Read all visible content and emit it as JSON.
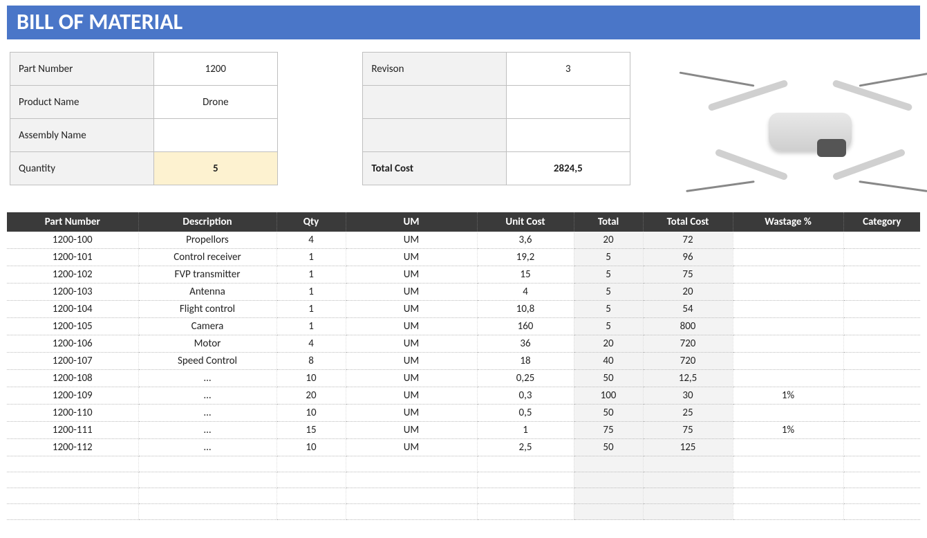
{
  "title": "BILL OF MATERIAL",
  "info_left": {
    "part_number_label": "Part Number",
    "part_number_value": "1200",
    "product_name_label": "Product Name",
    "product_name_value": "Drone",
    "assembly_name_label": "Assembly Name",
    "assembly_name_value": "",
    "quantity_label": "Quantity",
    "quantity_value": "5"
  },
  "info_right": {
    "revision_label": "Revison",
    "revision_value": "3",
    "row2_label": "",
    "row2_value": "",
    "row3_label": "",
    "row3_value": "",
    "total_cost_label": "Total Cost",
    "total_cost_value": "2824,5"
  },
  "headers": {
    "part_number": "Part Number",
    "description": "Description",
    "qty": "Qty",
    "um": "UM",
    "unit_cost": "Unit Cost",
    "total": "Total",
    "total_cost": "Total Cost",
    "wastage": "Wastage %",
    "category": "Category"
  },
  "rows": [
    {
      "pn": "1200-100",
      "desc": "Propellors",
      "qty": "4",
      "um": "UM",
      "uc": "3,6",
      "total": "20",
      "tc": "72",
      "wst": "",
      "cat": ""
    },
    {
      "pn": "1200-101",
      "desc": "Control receiver",
      "qty": "1",
      "um": "UM",
      "uc": "19,2",
      "total": "5",
      "tc": "96",
      "wst": "",
      "cat": ""
    },
    {
      "pn": "1200-102",
      "desc": "FVP transmitter",
      "qty": "1",
      "um": "UM",
      "uc": "15",
      "total": "5",
      "tc": "75",
      "wst": "",
      "cat": ""
    },
    {
      "pn": "1200-103",
      "desc": "Antenna",
      "qty": "1",
      "um": "UM",
      "uc": "4",
      "total": "5",
      "tc": "20",
      "wst": "",
      "cat": ""
    },
    {
      "pn": "1200-104",
      "desc": "Flight control",
      "qty": "1",
      "um": "UM",
      "uc": "10,8",
      "total": "5",
      "tc": "54",
      "wst": "",
      "cat": ""
    },
    {
      "pn": "1200-105",
      "desc": "Camera",
      "qty": "1",
      "um": "UM",
      "uc": "160",
      "total": "5",
      "tc": "800",
      "wst": "",
      "cat": ""
    },
    {
      "pn": "1200-106",
      "desc": "Motor",
      "qty": "4",
      "um": "UM",
      "uc": "36",
      "total": "20",
      "tc": "720",
      "wst": "",
      "cat": ""
    },
    {
      "pn": "1200-107",
      "desc": "Speed Control",
      "qty": "8",
      "um": "UM",
      "uc": "18",
      "total": "40",
      "tc": "720",
      "wst": "",
      "cat": ""
    },
    {
      "pn": "1200-108",
      "desc": "...",
      "qty": "10",
      "um": "UM",
      "uc": "0,25",
      "total": "50",
      "tc": "12,5",
      "wst": "",
      "cat": ""
    },
    {
      "pn": "1200-109",
      "desc": "...",
      "qty": "20",
      "um": "UM",
      "uc": "0,3",
      "total": "100",
      "tc": "30",
      "wst": "1%",
      "cat": ""
    },
    {
      "pn": "1200-110",
      "desc": "...",
      "qty": "10",
      "um": "UM",
      "uc": "0,5",
      "total": "50",
      "tc": "25",
      "wst": "",
      "cat": ""
    },
    {
      "pn": "1200-111",
      "desc": "...",
      "qty": "15",
      "um": "UM",
      "uc": "1",
      "total": "75",
      "tc": "75",
      "wst": "1%",
      "cat": ""
    },
    {
      "pn": "1200-112",
      "desc": "...",
      "qty": "10",
      "um": "UM",
      "uc": "2,5",
      "total": "50",
      "tc": "125",
      "wst": "",
      "cat": ""
    },
    {
      "pn": "",
      "desc": "",
      "qty": "",
      "um": "",
      "uc": "",
      "total": "",
      "tc": "",
      "wst": "",
      "cat": ""
    },
    {
      "pn": "",
      "desc": "",
      "qty": "",
      "um": "",
      "uc": "",
      "total": "",
      "tc": "",
      "wst": "",
      "cat": ""
    },
    {
      "pn": "",
      "desc": "",
      "qty": "",
      "um": "",
      "uc": "",
      "total": "",
      "tc": "",
      "wst": "",
      "cat": ""
    },
    {
      "pn": "",
      "desc": "",
      "qty": "",
      "um": "",
      "uc": "",
      "total": "",
      "tc": "",
      "wst": "",
      "cat": ""
    }
  ]
}
